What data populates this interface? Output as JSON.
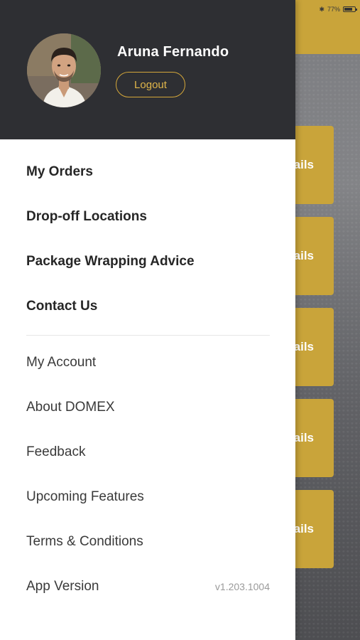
{
  "status_bar": {
    "battery_text": "77%",
    "bluetooth_icon": "bluetooth-icon",
    "battery_icon": "battery-icon"
  },
  "background": {
    "card_label_visible": "tails",
    "cards": [
      {
        "label": "tails"
      },
      {
        "label": "tails"
      },
      {
        "label": "tails"
      },
      {
        "label": "tails"
      },
      {
        "label": "tails"
      }
    ],
    "accent_color": "#c9a43a"
  },
  "drawer": {
    "user": {
      "name": "Aruna Fernando",
      "avatar_icon": "avatar"
    },
    "logout_label": "Logout",
    "primary_items": [
      {
        "label": "My Orders"
      },
      {
        "label": "Drop-off Locations"
      },
      {
        "label": "Package Wrapping Advice"
      },
      {
        "label": "Contact Us"
      }
    ],
    "secondary_items": [
      {
        "label": "My Account"
      },
      {
        "label": "About DOMEX"
      },
      {
        "label": "Feedback"
      },
      {
        "label": "Upcoming Features"
      },
      {
        "label": "Terms & Conditions"
      }
    ],
    "app_version": {
      "label": "App Version",
      "value": "v1.203.1004"
    },
    "header_color": "#2e2f33",
    "accent_color": "#d4a73a"
  }
}
